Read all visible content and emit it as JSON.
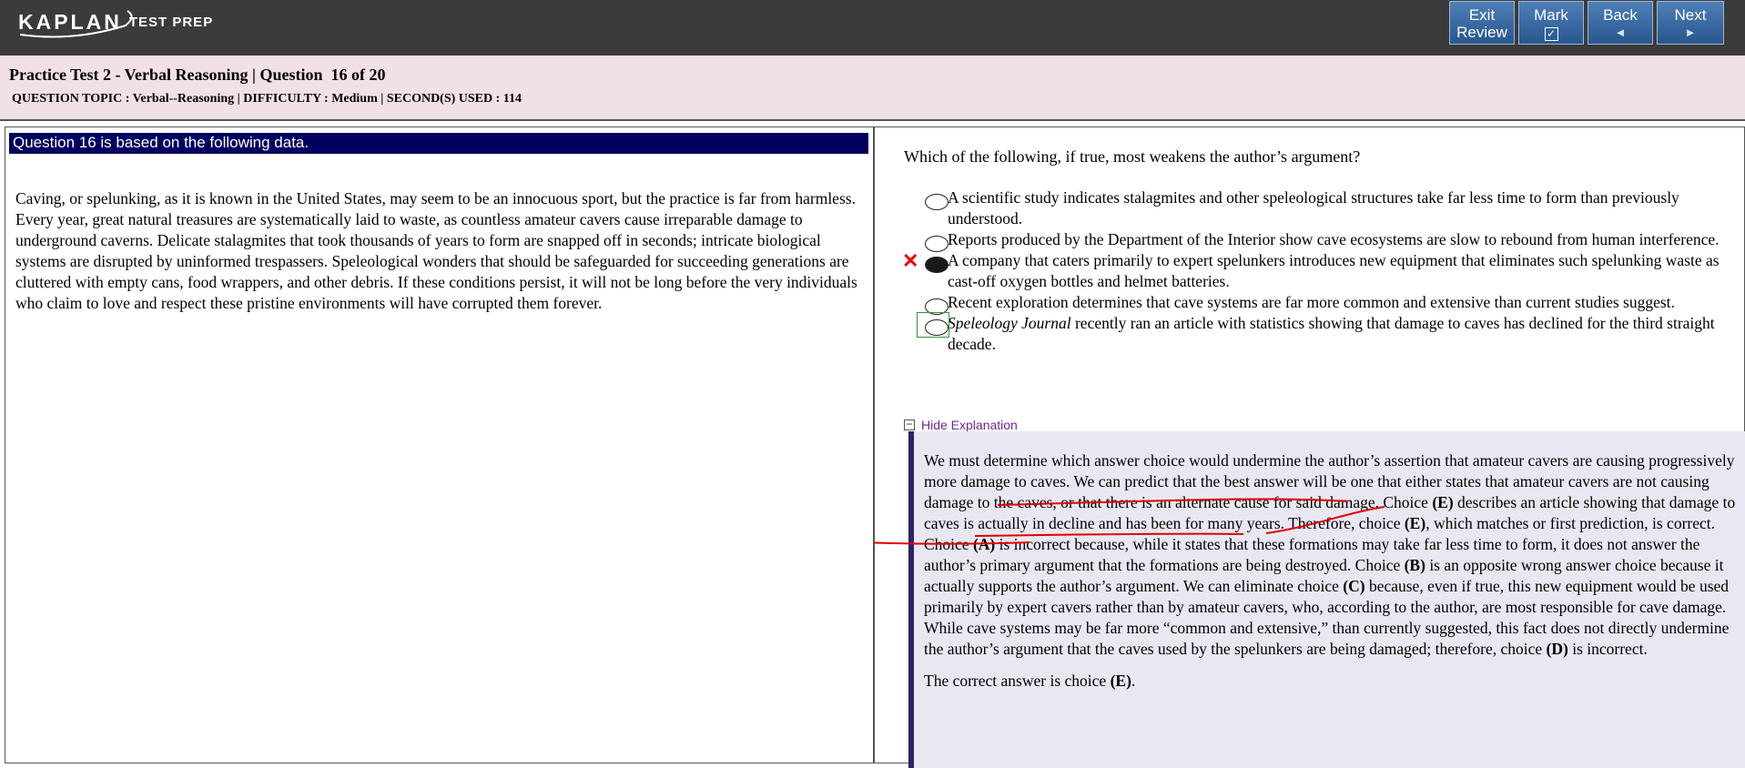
{
  "brand": {
    "name": "KAPLAN",
    "sub": "TEST PREP"
  },
  "nav": {
    "exit": {
      "line1": "Exit",
      "line2": "Review"
    },
    "mark": {
      "label": "Mark",
      "glyph": "✓"
    },
    "back": {
      "label": "Back",
      "arrow": "◄"
    },
    "next": {
      "label": "Next",
      "arrow": "►"
    }
  },
  "header": {
    "title": "Practice Test 2 - Verbal Reasoning | Question  16 of 20",
    "meta": "QUESTION TOPIC : Verbal--Reasoning | DIFFICULTY : Medium | SECOND(S) USED : 114"
  },
  "passage": {
    "heading": "Question 16 is based on the following data.",
    "text": "Caving, or spelunking, as it is known in the United States, may seem to be an innocuous sport, but the practice is far from harmless. Every year, great natural treasures are systematically laid to waste, as countless amateur cavers cause irreparable damage to underground caverns. Delicate stalagmites that took thousands of years to form are snapped off in seconds; intricate biological systems are disrupted by uninformed trespassers. Speleological wonders that should be safeguarded for succeeding generations are cluttered with empty cans, food wrappers, and other debris. If these conditions persist, it will not be long before the very individuals who claim to love and respect these pristine environments will have corrupted them forever."
  },
  "question": {
    "stem": "Which of the following, if true, most weakens the author’s argument?",
    "choices": [
      {
        "text": "A scientific study indicates stalagmites and other speleological structures take far less time to form than previously understood."
      },
      {
        "text": "Reports produced by the Department of the Interior show cave ecosystems are slow to rebound from human interference."
      },
      {
        "text": "A company that caters primarily to expert spelunkers introduces new equipment that eliminates such spelunking waste as cast-off oxygen bottles and helmet batteries.",
        "selected": true,
        "mark": "✕"
      },
      {
        "text": "Recent exploration determines that cave systems are far more common and extensive than current studies suggest."
      },
      {
        "em": "Speleology Journal",
        "text": " recently ran an article with statistics showing that damage to caves has declined for the third straight decade.",
        "correct": true
      }
    ]
  },
  "explanation": {
    "toggle_glyph": "−",
    "toggle_label": "Hide Explanation",
    "p1": [
      "We must determine which answer choice would undermine the author’s assertion that amateur cavers are causing progressively more damage to caves. We can predict that the best answer will be one that either states that amateur cavers are not causing damage to the caves, or that there is an alternate cause for said damage. Choice ",
      "(E)",
      " describes an article showing that damage to caves is actually in decline and has been for many years. Therefore, choice ",
      "(E)",
      ", which matches or first prediction, is correct. Choice ",
      "(A)",
      " is incorrect because, while it states that these formations may take far less time to form, it does not answer the author’s primary argument that the formations are being destroyed. Choice ",
      "(B)",
      " is an opposite wrong answer choice because it actually supports the author’s argument. We can eliminate choice ",
      "(C)",
      " because, even if true, this new equipment would be used primarily by expert cavers rather than by amateur cavers, who, according to the author, are most responsible for cave damage. While cave systems may be far more “common and extensive,” than currently suggested, this fact does not directly undermine the author’s argument that the caves used by the spelunkers are being damaged; therefore, choice ",
      "(D)",
      " is incorrect."
    ],
    "p2": [
      "The correct answer is choice ",
      "(E)",
      "."
    ]
  },
  "colors": {
    "topbar": "#3b3b3b",
    "subheader": "#f2e1e4",
    "passage_head": "#00005e",
    "button": "#3a6aa3",
    "annotation": "#e00000",
    "correct_box": "#2a9a3a"
  }
}
